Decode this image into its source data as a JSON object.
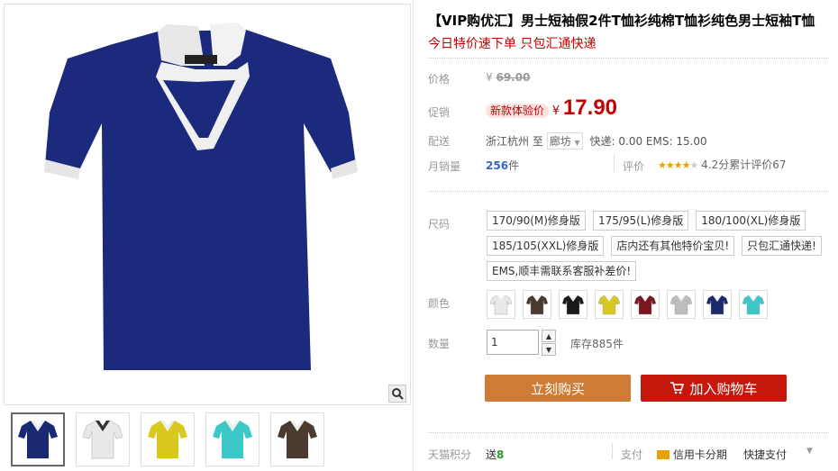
{
  "product": {
    "title": "【VIP购优汇】男士短袖假2件T恤衫纯棉T恤衫纯色男士短袖T恤",
    "subtitle": "今日特价速下单 只包汇通快递"
  },
  "price": {
    "label": "价格",
    "currency": "¥",
    "original": "69.00"
  },
  "promo": {
    "label": "促销",
    "tag": "新款体验价",
    "currency": "¥",
    "value": "17.90"
  },
  "shipping": {
    "label": "配送",
    "from": "浙江杭州",
    "to_word": "至",
    "destination": "廊坊",
    "fee": "快递: 0.00 EMS: 15.00"
  },
  "sales": {
    "label": "月销量",
    "count": "256",
    "unit": "件",
    "review_label": "评价",
    "rating_text": "4.2分累计评价67",
    "rating": 4.2
  },
  "size": {
    "label": "尺码",
    "options": [
      "170/90(M)修身版",
      "175/95(L)修身版",
      "180/100(XL)修身版",
      "185/105(XXL)修身版",
      "店内还有其他特价宝贝!",
      "只包汇通快递!",
      "EMS,顺丰需联系客服补差价!"
    ]
  },
  "color": {
    "label": "颜色",
    "swatches": [
      "#e8e8e8",
      "#4a3a30",
      "#1a1a1a",
      "#d8c820",
      "#7a1620",
      "#bdbdbd",
      "#1a2a6a",
      "#3cc8c8"
    ]
  },
  "quantity": {
    "label": "数量",
    "value": "1",
    "stock": "库存885件"
  },
  "actions": {
    "buy_now": "立刻购买",
    "add_to_cart": "加入购物车"
  },
  "footer": {
    "points_label": "天猫积分",
    "points_prefix": "送",
    "points_value": "8",
    "pay_label": "支付",
    "credit_card": "信用卡分期",
    "express_pay": "快捷支付"
  },
  "gallery": {
    "thumbs": [
      "#1a2a72",
      "#e8e8e8",
      "#d8c820",
      "#3cc8c8",
      "#4a3a30"
    ]
  },
  "colors": {
    "accent_red": "#c40000",
    "buy_orange": "#cd7b35",
    "cart_red": "#c4180c"
  }
}
